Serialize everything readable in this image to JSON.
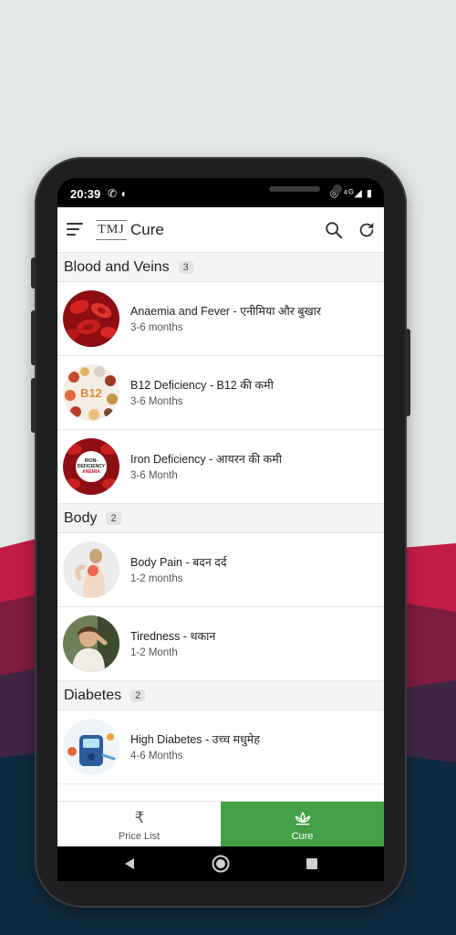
{
  "status_bar": {
    "time": "20:39",
    "left_icons": "✆ ◖",
    "right_icons": "◎ ⁴ᴳ◢ ▮"
  },
  "app_bar": {
    "logo_text": "TMJ",
    "title": "Cure",
    "menu_icon": "hamburger-icon",
    "search_icon": "search-icon",
    "refresh_icon": "refresh-icon"
  },
  "sections": [
    {
      "title": "Blood and Veins",
      "count": "3",
      "items": [
        {
          "title": "Anaemia and Fever - एनीमिया और बुखार",
          "duration": "3-6 months",
          "thumb": "red-blood-cells"
        },
        {
          "title": "B12 Deficiency - B12 की कमी",
          "duration": "3-6 Months",
          "thumb": "b12-foods",
          "thumb_label": "B12"
        },
        {
          "title": "Iron Deficiency - आयरन की कमी",
          "duration": "3-6 Month",
          "thumb": "iron-deficiency-anemia",
          "thumb_label_1": "IRON-",
          "thumb_label_2": "DEFICIENCY",
          "thumb_label_3": "ANEMIA"
        }
      ]
    },
    {
      "title": "Body",
      "count": "2",
      "items": [
        {
          "title": "Body Pain - बदन दर्द",
          "duration": "1-2 months",
          "thumb": "back-pain-person"
        },
        {
          "title": "Tiredness - थकान",
          "duration": "1-2 Month",
          "thumb": "tired-person"
        }
      ]
    },
    {
      "title": "Diabetes",
      "count": "2",
      "items": [
        {
          "title": "High Diabetes - उच्च मधुमेह",
          "duration": "4-6 Months",
          "thumb": "glucose-meter"
        }
      ]
    }
  ],
  "bottom_nav": {
    "price_list": {
      "label": "Price List",
      "icon": "₹"
    },
    "cure": {
      "label": "Cure",
      "icon": "lotus-icon",
      "active": true
    }
  },
  "colors": {
    "active_tab": "#43a047",
    "background_top": "#e3e8e6",
    "mountain_red": "#c21e45",
    "mountain_dark": "#0f2a3e"
  }
}
